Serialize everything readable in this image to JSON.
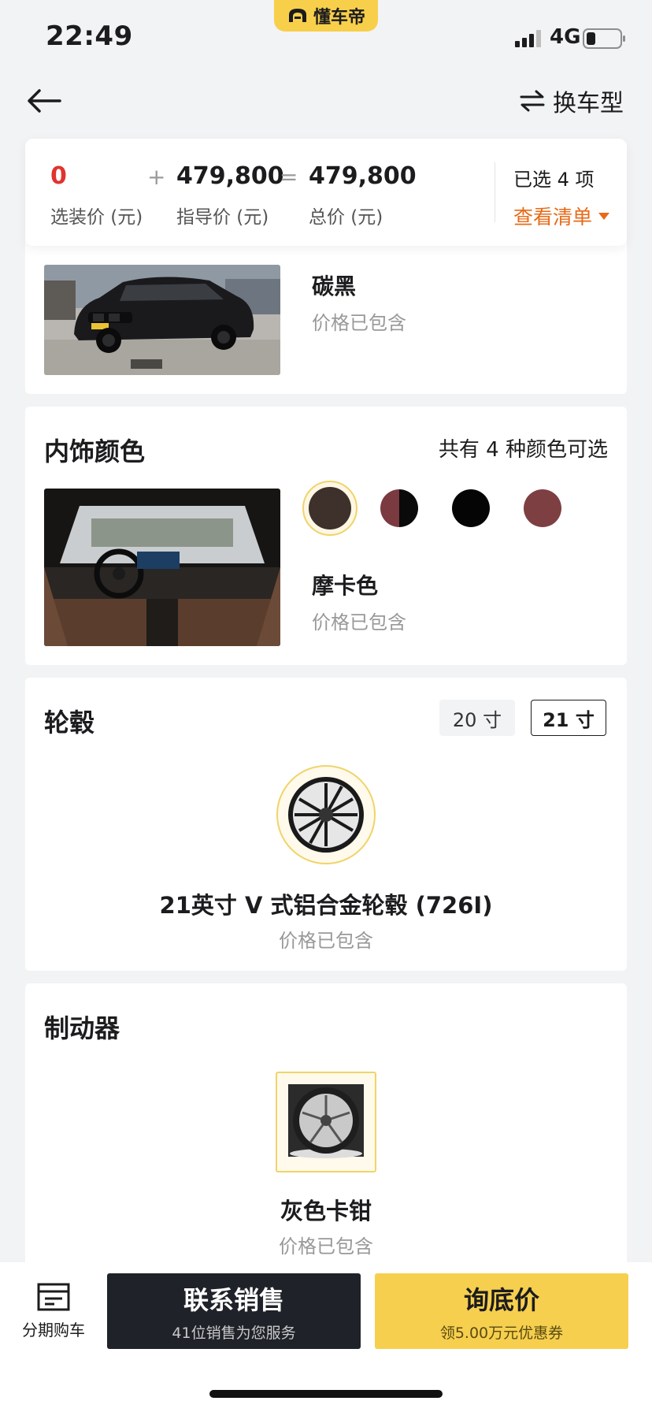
{
  "status_bar": {
    "time": "22:49",
    "network": "4G",
    "brand": "懂车帝"
  },
  "header": {
    "switch_label": "换车型"
  },
  "price_summary": {
    "optional_price": "0",
    "optional_label": "选装价 (元)",
    "plus": "+",
    "guide_price": "479,800",
    "guide_label": "指导价 (元)",
    "equals": "=",
    "total_price": "479,800",
    "total_label": "总价 (元)",
    "selected_count": "已选 4 项",
    "view_list": "查看清单"
  },
  "exterior": {
    "color_name": "碳黑",
    "price_note": "价格已包含"
  },
  "interior": {
    "title": "内饰颜色",
    "color_count_note": "共有 4 种颜色可选",
    "color_name": "摩卡色",
    "price_note": "价格已包含",
    "swatches": [
      {
        "color": "#3e302b"
      },
      {
        "color_left": "#7a3a40",
        "color_right": "#0a0a0a"
      },
      {
        "color": "#050505"
      },
      {
        "color": "#7e3f42"
      }
    ]
  },
  "wheels": {
    "title": "轮毂",
    "sizes": [
      "20 寸",
      "21 寸"
    ],
    "selected_size": "21 寸",
    "name": "21英寸 V 式铝合金轮毂 (726I)",
    "price_note": "价格已包含"
  },
  "brakes": {
    "title": "制动器",
    "name": "灰色卡钳",
    "price_note": "价格已包含"
  },
  "bottom_bar": {
    "installment_label": "分期购车",
    "contact_title": "联系销售",
    "contact_sub": "41位销售为您服务",
    "inquiry_title": "询底价",
    "inquiry_sub": "领5.00万元优惠券"
  },
  "colors": {
    "accent_red": "#e0342e",
    "accent_orange": "#e86a17",
    "brand_yellow": "#f6cf4f",
    "dark_button": "#1f2229"
  }
}
